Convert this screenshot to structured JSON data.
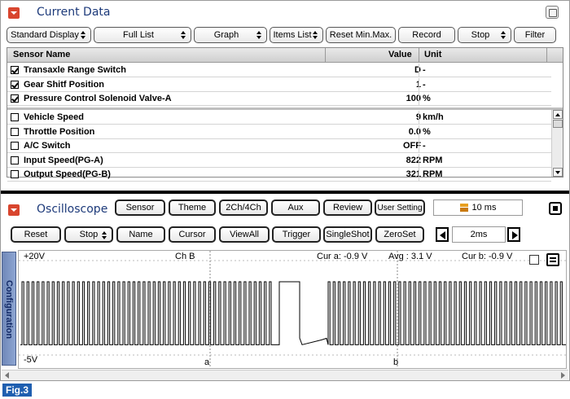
{
  "current_data": {
    "title": "Current Data",
    "toolbar": [
      {
        "label": "Standard Display",
        "spinner": true,
        "w": 104
      },
      {
        "label": "Full List",
        "spinner": true,
        "w": 120
      },
      {
        "label": "Graph",
        "spinner": true,
        "w": 90
      },
      {
        "label": "Items List",
        "spinner": true,
        "w": 66
      },
      {
        "label": "Reset Min.Max.",
        "spinner": false,
        "w": 86
      },
      {
        "label": "Record",
        "spinner": false,
        "w": 70
      },
      {
        "label": "Stop",
        "spinner": true,
        "w": 66
      },
      {
        "label": "Filter",
        "spinner": false,
        "w": 52
      }
    ],
    "columns": {
      "name": "Sensor Name",
      "value": "Value",
      "unit": "Unit"
    },
    "pinned_rows": [
      {
        "checked": true,
        "name": "Transaxle Range Switch",
        "value": "D",
        "unit": "-"
      },
      {
        "checked": true,
        "name": "Gear Shitf Position",
        "value": "1",
        "unit": "-"
      },
      {
        "checked": true,
        "name": "Pressure Control Solenoid Valve-A",
        "value": "100",
        "unit": "%"
      }
    ],
    "rows": [
      {
        "checked": false,
        "name": "Vehicle Speed",
        "value": "9",
        "unit": "km/h"
      },
      {
        "checked": false,
        "name": "Throttle Position",
        "value": "0.0",
        "unit": "%"
      },
      {
        "checked": false,
        "name": "A/C Switch",
        "value": "OFF",
        "unit": "-"
      },
      {
        "checked": false,
        "name": "Input Speed(PG-A)",
        "value": "822",
        "unit": "RPM"
      },
      {
        "checked": false,
        "name": "Output Speed(PG-B)",
        "value": "321",
        "unit": "RPM"
      }
    ]
  },
  "oscilloscope": {
    "title": "Oscilloscope",
    "top_buttons": [
      "Sensor",
      "Theme",
      "2Ch/4Ch",
      "Aux",
      "Review",
      "User Setting"
    ],
    "time_display": "10 ms",
    "controls": {
      "reset": "Reset",
      "stop": "Stop",
      "name": "Name",
      "cursor": "Cursor",
      "viewall": "ViewAll",
      "trigger": "Trigger",
      "singleshot": "SingleShot",
      "zeroset": "ZeroSet",
      "timebase": "2ms"
    },
    "side_tab": "Configuration",
    "readouts": {
      "top_voltage": "+20V",
      "bottom_voltage": "-5V",
      "channel": "Ch B",
      "cur_a": "Cur a: -0.9 V",
      "avg": "Avg : 3.1 V",
      "cur_b": "Cur b: -0.9 V",
      "cursor_a_label": "a",
      "cursor_b_label": "b"
    },
    "waveform": {
      "description_free": true,
      "high_level": 0.26,
      "low_level": 0.79
    }
  },
  "figure_label": "Fig.3",
  "colors": {
    "accent_red": "#d8452e",
    "title_blue": "#1d3a7a",
    "config_tab": "#7f97c6",
    "fig_label_bg": "#1f5fb0"
  }
}
